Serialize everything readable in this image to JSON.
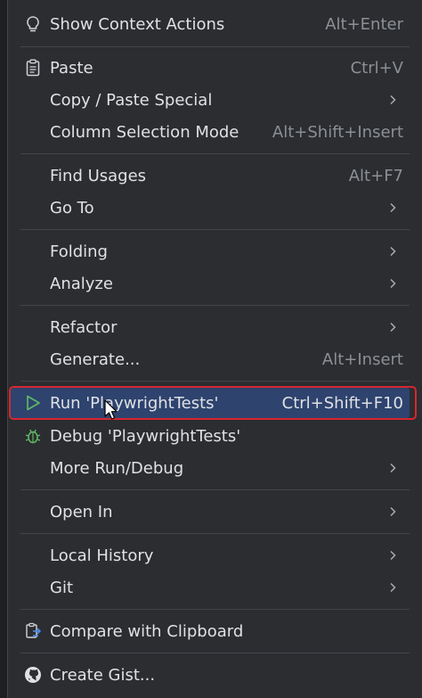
{
  "menu": {
    "items": [
      {
        "label": "Show Context Actions",
        "shortcut": "Alt+Enter",
        "icon": "lightbulb-icon"
      },
      {
        "label": "Paste",
        "shortcut": "Ctrl+V",
        "icon": "clipboard-icon"
      },
      {
        "label": "Copy / Paste Special",
        "shortcut": "",
        "icon": ""
      },
      {
        "label": "Column Selection Mode",
        "shortcut": "Alt+Shift+Insert",
        "icon": ""
      },
      {
        "label": "Find Usages",
        "shortcut": "Alt+F7",
        "icon": ""
      },
      {
        "label": "Go To",
        "shortcut": "",
        "icon": ""
      },
      {
        "label": "Folding",
        "shortcut": "",
        "icon": ""
      },
      {
        "label": "Analyze",
        "shortcut": "",
        "icon": ""
      },
      {
        "label": "Refactor",
        "shortcut": "",
        "icon": ""
      },
      {
        "label": "Generate...",
        "shortcut": "Alt+Insert",
        "icon": ""
      },
      {
        "label": "Run 'PlaywrightTests'",
        "shortcut": "Ctrl+Shift+F10",
        "icon": "run-icon"
      },
      {
        "label": "Debug 'PlaywrightTests'",
        "shortcut": "",
        "icon": "debug-icon"
      },
      {
        "label": "More Run/Debug",
        "shortcut": "",
        "icon": ""
      },
      {
        "label": "Open In",
        "shortcut": "",
        "icon": ""
      },
      {
        "label": "Local History",
        "shortcut": "",
        "icon": ""
      },
      {
        "label": "Git",
        "shortcut": "",
        "icon": ""
      },
      {
        "label": "Compare with Clipboard",
        "shortcut": "",
        "icon": "compare-icon"
      },
      {
        "label": "Create Gist...",
        "shortcut": "",
        "icon": "github-icon"
      }
    ],
    "highlighted_item": "Run 'PlaywrightTests'"
  },
  "colors": {
    "background": "#2b2d30",
    "text": "#dfe1e5",
    "shortcut_text": "#8c8f94",
    "highlight": "#2e436e",
    "highlight_border": "#d6262f",
    "run_icon": "#5fb865"
  }
}
